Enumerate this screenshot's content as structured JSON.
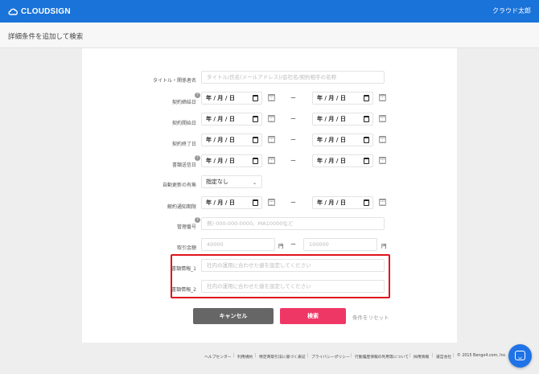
{
  "header": {
    "logo_text": "CLOUDSIGN",
    "user_name": "クラウド太郎"
  },
  "subheader": {
    "title": "詳細条件を追加して検索"
  },
  "form": {
    "title_label": "タイトル・関係者名",
    "title_placeholder": "タイトル/氏名(メールアドレス)/会社名/契約相手の名称",
    "contract_date_label": "契約締結日",
    "start_date_label": "契約開始日",
    "end_date_label": "契約終了日",
    "sent_date_label": "書類送信日",
    "auto_renew_label": "自動更新の有無",
    "auto_renew_value": "指定なし",
    "cancel_period_label": "解約通知期限",
    "mgmt_number_label": "管理番号",
    "mgmt_number_placeholder": "例) 000-000-0000、MA10000など",
    "amount_label": "取引金額",
    "amount_min_placeholder": "40000",
    "amount_max_placeholder": "100000",
    "currency_unit": "円",
    "date_placeholder": "年 / 月 / 日",
    "range_separator": "ー",
    "help_glyph": "?",
    "doc_info_1_label": "書類情報_1",
    "doc_info_2_label": "書類情報_2",
    "doc_info_placeholder": "社内の運用に合わせた値を設定してください"
  },
  "actions": {
    "cancel_label": "キャンセル",
    "search_label": "検索",
    "reset_label": "条件をリセット"
  },
  "footer": {
    "links": [
      "ヘルプセンター",
      "利用規約",
      "特定商取引法に基づく表記",
      "プライバシーポリシー",
      "行動履歴情報の利用等について",
      "採用情報",
      "運営会社"
    ],
    "copyright": "© 2015 Bengo4.com, Inc."
  },
  "colors": {
    "brand_blue": "#1a73d9",
    "search_pink": "#ef3766",
    "highlight_red": "#e0141c"
  }
}
